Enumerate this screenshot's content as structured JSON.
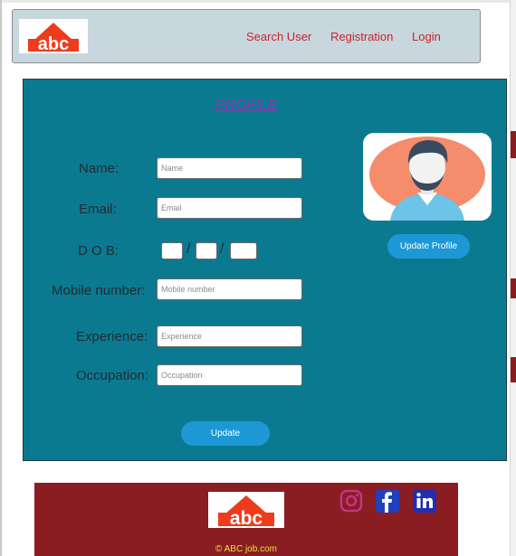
{
  "brand": {
    "logo_text": "abc",
    "logo_color": "#ee3b1c"
  },
  "header": {
    "nav": [
      {
        "label": "Search User"
      },
      {
        "label": "Registration"
      },
      {
        "label": "Login"
      }
    ]
  },
  "profile": {
    "title": "PROFILE",
    "fields": {
      "name": {
        "label": "Name:",
        "placeholder": "Name"
      },
      "email": {
        "label": "Email:",
        "placeholder": "Email"
      },
      "dob": {
        "label": "D O B:",
        "separator": "/"
      },
      "mobile": {
        "label": "Mobile number:",
        "placeholder": "Mobile number"
      },
      "experience": {
        "label": "Experience:",
        "placeholder": "Experience"
      },
      "occupation": {
        "label": "Occupation:",
        "placeholder": "Occupation"
      }
    },
    "update_label": "Update",
    "update_profile_label": "Update Profile"
  },
  "footer": {
    "copyright": "© ABC job.com",
    "social": [
      "instagram-icon",
      "facebook-icon",
      "linkedin-icon"
    ]
  },
  "colors": {
    "panel_bg": "#0b7a90",
    "header_bg": "#c8d6dd",
    "footer_bg": "#8a1d22",
    "nav_link": "#c8242c",
    "button": "#1b98d5",
    "copyright": "#e8e23a"
  }
}
